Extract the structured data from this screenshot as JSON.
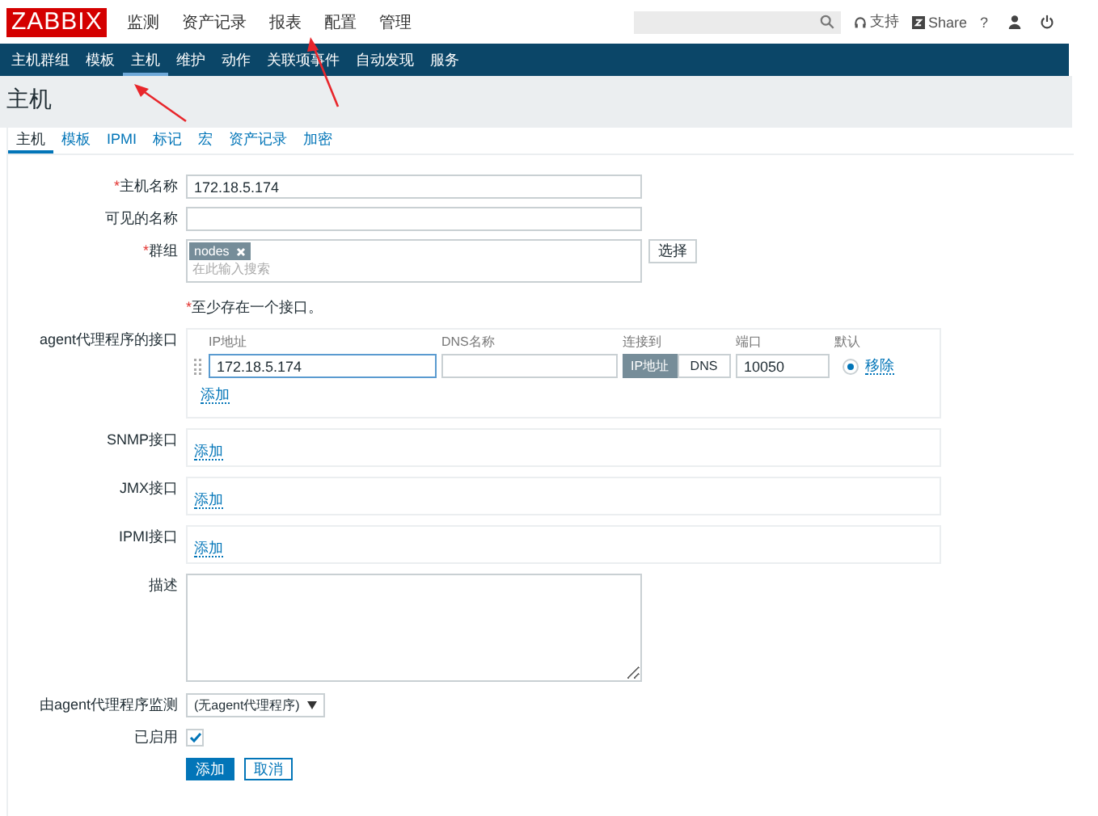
{
  "header": {
    "logo": "ZABBIX",
    "menu": [
      {
        "label": "监测"
      },
      {
        "label": "资产记录"
      },
      {
        "label": "报表"
      },
      {
        "label": "配置"
      },
      {
        "label": "管理"
      }
    ],
    "support": "支持",
    "share": "Share",
    "help": "?"
  },
  "subnav": [
    {
      "label": "主机群组",
      "selected": false
    },
    {
      "label": "模板",
      "selected": false
    },
    {
      "label": "主机",
      "selected": true
    },
    {
      "label": "维护",
      "selected": false
    },
    {
      "label": "动作",
      "selected": false
    },
    {
      "label": "关联项事件",
      "selected": false
    },
    {
      "label": "自动发现",
      "selected": false
    },
    {
      "label": "服务",
      "selected": false
    }
  ],
  "page_title": "主机",
  "tabs": [
    {
      "label": "主机",
      "selected": true
    },
    {
      "label": "模板",
      "selected": false
    },
    {
      "label": "IPMI",
      "selected": false
    },
    {
      "label": "标记",
      "selected": false
    },
    {
      "label": "宏",
      "selected": false
    },
    {
      "label": "资产记录",
      "selected": false
    },
    {
      "label": "加密",
      "selected": false
    }
  ],
  "required_mark": "*",
  "form": {
    "host_name": {
      "label": "主机名称",
      "required": true,
      "value": "172.18.5.174"
    },
    "visible_name": {
      "label": "可见的名称",
      "required": false
    },
    "groups": {
      "label": "群组",
      "required": true,
      "tags": [
        "nodes"
      ],
      "placeholder": "在此输入搜索",
      "button": "选择"
    },
    "interface_note": "至少存在一个接口。",
    "agent_interfaces": {
      "label": "agent代理程序的接口",
      "columns": [
        "IP地址",
        "DNS名称",
        "连接到",
        "端口",
        "默认"
      ],
      "rows": [
        {
          "ip": "172.18.5.174",
          "connect": [
            {
              "label": "IP地址",
              "selected": true
            },
            {
              "label": "DNS",
              "selected": false
            }
          ],
          "port": "10050",
          "default": true,
          "remove": "移除"
        }
      ],
      "add": "添加"
    },
    "other_interfaces": [
      {
        "label": "SNMP接口",
        "add": "添加"
      },
      {
        "label": "JMX接口",
        "add": "添加"
      },
      {
        "label": "IPMI接口",
        "add": "添加"
      }
    ],
    "description": {
      "label": "描述"
    },
    "proxy": {
      "label": "由agent代理程序监测",
      "value": "(无agent代理程序)"
    },
    "enabled": {
      "label": "已启用",
      "checked": true
    },
    "buttons": [
      {
        "label": "添加",
        "kind": "primary"
      },
      {
        "label": "取消",
        "kind": "secondary"
      }
    ]
  }
}
